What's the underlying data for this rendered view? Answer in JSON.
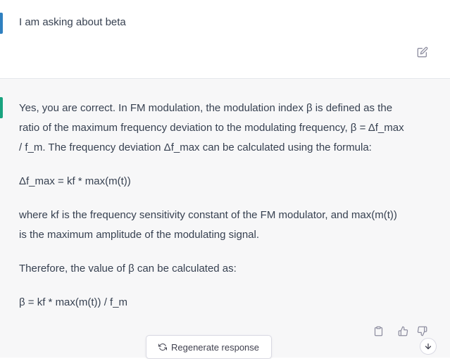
{
  "colors": {
    "user_accent": "#2f80c0",
    "assistant_accent": "#19a37f",
    "assistant_bg": "#f7f7f8",
    "text": "#374151",
    "icon": "#8e8ea0"
  },
  "user_message": {
    "text": "I am asking about beta",
    "edit_icon": "edit-icon"
  },
  "assistant_message": {
    "paragraphs": [
      [
        "Yes, you are correct. In FM modulation, the modulation index β is defined as the",
        "ratio of the maximum frequency deviation to the modulating frequency, β = Δf_max",
        "/ f_m. The frequency deviation Δf_max can be calculated using the formula:"
      ],
      [
        "Δf_max = kf * max(m(t))"
      ],
      [
        "where kf is the frequency sensitivity constant of the FM modulator, and max(m(t))",
        "is the maximum amplitude of the modulating signal."
      ],
      [
        "Therefore, the value of β can be calculated as:"
      ],
      [
        "β = kf * max(m(t)) / f_m"
      ]
    ],
    "actions": [
      "clipboard-icon",
      "thumbs-up-icon",
      "thumbs-down-icon"
    ]
  },
  "regenerate": {
    "label": "Regenerate response",
    "icon": "refresh-icon"
  },
  "scroll_down": {
    "icon": "arrow-down-icon"
  }
}
